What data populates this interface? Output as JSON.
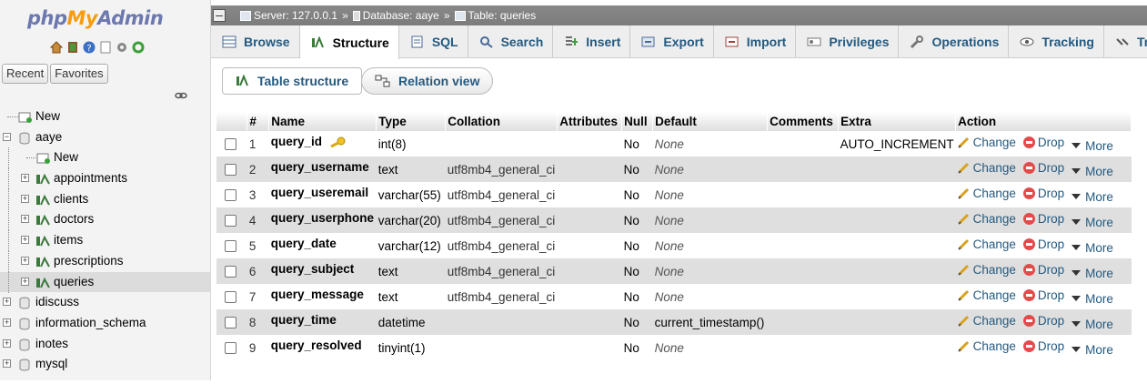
{
  "logo": {
    "php": "php",
    "my": "My",
    "admin": "Admin"
  },
  "nav": {
    "tabs": [
      {
        "label": "Recent"
      },
      {
        "label": "Favorites"
      }
    ],
    "tree": [
      {
        "label": "New",
        "level": 0,
        "icon": "new-icon"
      },
      {
        "label": "aaye",
        "level": 0,
        "icon": "database-icon",
        "expanded": true
      },
      {
        "label": "New",
        "level": 1,
        "icon": "new-table-icon"
      },
      {
        "label": "appointments",
        "level": 1,
        "icon": "table-icon"
      },
      {
        "label": "clients",
        "level": 1,
        "icon": "table-icon"
      },
      {
        "label": "doctors",
        "level": 1,
        "icon": "table-icon"
      },
      {
        "label": "items",
        "level": 1,
        "icon": "table-icon"
      },
      {
        "label": "prescriptions",
        "level": 1,
        "icon": "table-icon"
      },
      {
        "label": "queries",
        "level": 1,
        "icon": "table-icon",
        "selected": true
      },
      {
        "label": "idiscuss",
        "level": 0,
        "icon": "database-icon"
      },
      {
        "label": "information_schema",
        "level": 0,
        "icon": "database-icon"
      },
      {
        "label": "inotes",
        "level": 0,
        "icon": "database-icon"
      },
      {
        "label": "mysql",
        "level": 0,
        "icon": "database-icon"
      }
    ]
  },
  "breadcrumb": {
    "server": "Server: 127.0.0.1",
    "database": "Database: aaye",
    "table": "Table: queries",
    "sep": "»"
  },
  "tabs": [
    {
      "label": "Browse",
      "icon": "browse-icon"
    },
    {
      "label": "Structure",
      "icon": "structure-icon",
      "active": true
    },
    {
      "label": "SQL",
      "icon": "sql-icon"
    },
    {
      "label": "Search",
      "icon": "search-icon"
    },
    {
      "label": "Insert",
      "icon": "insert-icon"
    },
    {
      "label": "Export",
      "icon": "export-icon"
    },
    {
      "label": "Import",
      "icon": "import-icon"
    },
    {
      "label": "Privileges",
      "icon": "privileges-icon"
    },
    {
      "label": "Operations",
      "icon": "wrench-icon"
    },
    {
      "label": "Tracking",
      "icon": "eye-icon"
    },
    {
      "label": "Trigg",
      "icon": "triggers-icon"
    }
  ],
  "subtabs": {
    "structure": "Table structure",
    "relation": "Relation view"
  },
  "table": {
    "headers": [
      "#",
      "Name",
      "Type",
      "Collation",
      "Attributes",
      "Null",
      "Default",
      "Comments",
      "Extra",
      "Action"
    ],
    "actions": {
      "change": "Change",
      "drop": "Drop",
      "more": "More"
    },
    "rows": [
      {
        "num": "1",
        "name": "query_id",
        "type": "int(8)",
        "collation": "",
        "attributes": "",
        "null": "No",
        "default": "None",
        "comments": "",
        "extra": "AUTO_INCREMENT",
        "primary": true
      },
      {
        "num": "2",
        "name": "query_username",
        "type": "text",
        "collation": "utf8mb4_general_ci",
        "attributes": "",
        "null": "No",
        "default": "None",
        "comments": "",
        "extra": ""
      },
      {
        "num": "3",
        "name": "query_useremail",
        "type": "varchar(55)",
        "collation": "utf8mb4_general_ci",
        "attributes": "",
        "null": "No",
        "default": "None",
        "comments": "",
        "extra": ""
      },
      {
        "num": "4",
        "name": "query_userphone",
        "type": "varchar(20)",
        "collation": "utf8mb4_general_ci",
        "attributes": "",
        "null": "No",
        "default": "None",
        "comments": "",
        "extra": ""
      },
      {
        "num": "5",
        "name": "query_date",
        "type": "varchar(12)",
        "collation": "utf8mb4_general_ci",
        "attributes": "",
        "null": "No",
        "default": "None",
        "comments": "",
        "extra": ""
      },
      {
        "num": "6",
        "name": "query_subject",
        "type": "text",
        "collation": "utf8mb4_general_ci",
        "attributes": "",
        "null": "No",
        "default": "None",
        "comments": "",
        "extra": ""
      },
      {
        "num": "7",
        "name": "query_message",
        "type": "text",
        "collation": "utf8mb4_general_ci",
        "attributes": "",
        "null": "No",
        "default": "None",
        "comments": "",
        "extra": ""
      },
      {
        "num": "8",
        "name": "query_time",
        "type": "datetime",
        "collation": "",
        "attributes": "",
        "null": "No",
        "default": "current_timestamp()",
        "comments": "",
        "extra": ""
      },
      {
        "num": "9",
        "name": "query_resolved",
        "type": "tinyint(1)",
        "collation": "",
        "attributes": "",
        "null": "No",
        "default": "None",
        "comments": "",
        "extra": ""
      }
    ]
  }
}
